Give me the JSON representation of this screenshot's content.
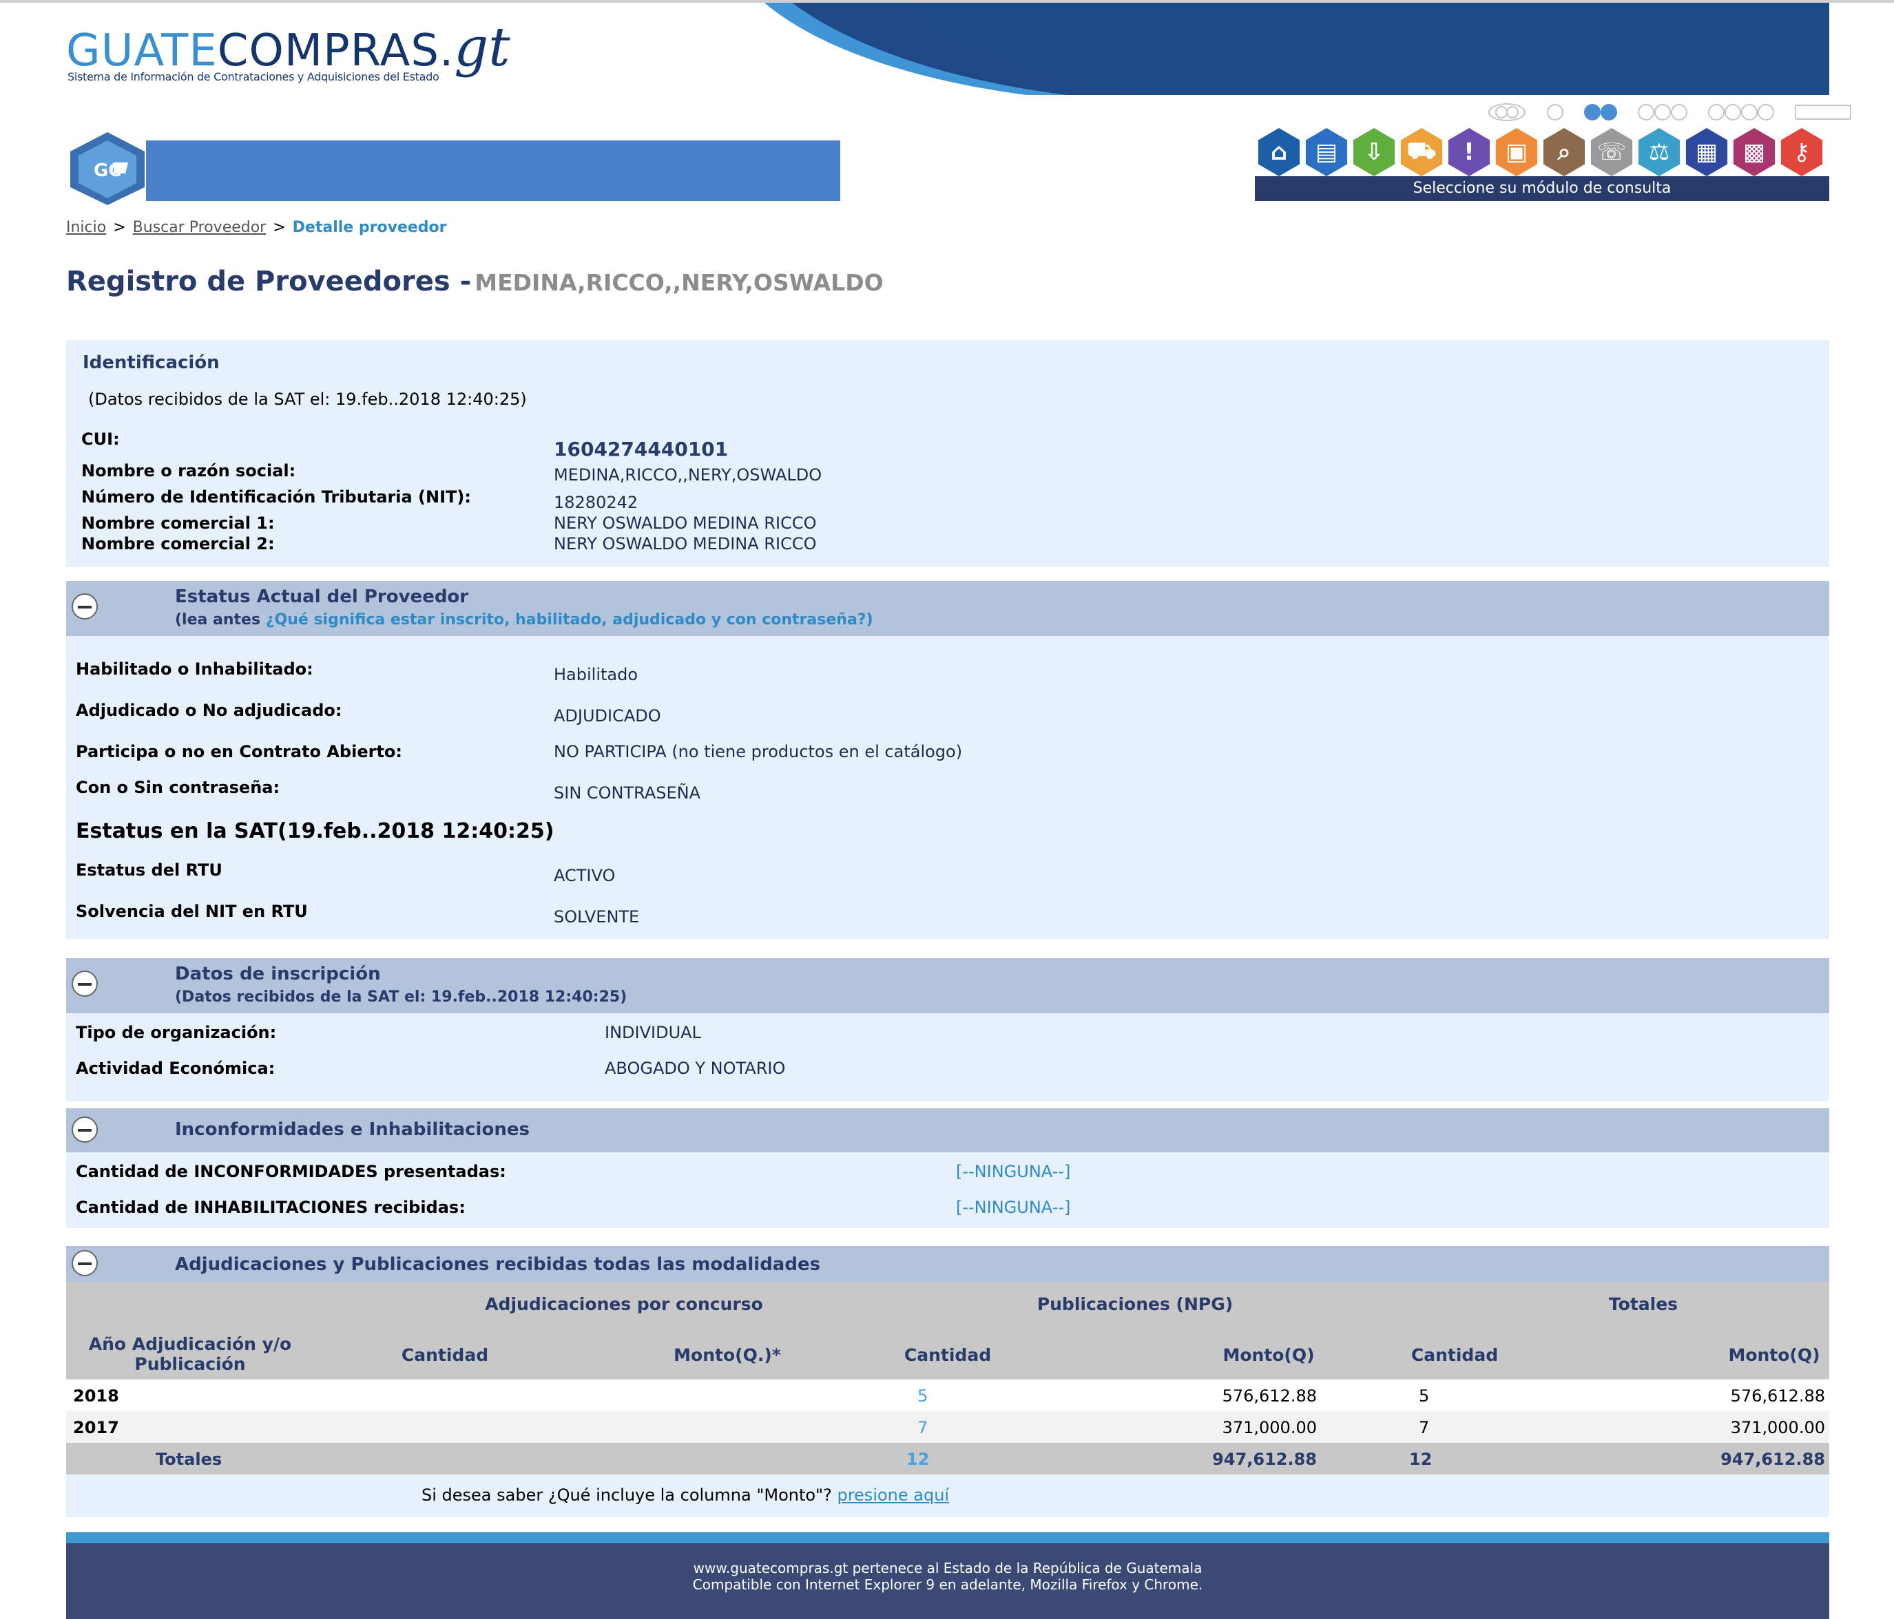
{
  "header": {
    "logo_part1": "GUATE",
    "logo_part2": "COMPRAS.",
    "logo_part3": "gt",
    "logo_subtitle": "Sistema de Información de Contrataciones y Adquisiciones del Estado",
    "gc_logo_text": "GC",
    "modules_label": "Seleccione su módulo de consulta",
    "module_icons": [
      "home-icon",
      "document-icon",
      "download-icon",
      "cart-icon",
      "alert-icon",
      "pac-icon",
      "search-icon",
      "phone-icon",
      "scale-icon",
      "report-icon",
      "grid-icon",
      "key-icon"
    ],
    "module_colors": [
      "#1d5ea8",
      "#2a6fc2",
      "#5fae3e",
      "#eda13a",
      "#6a4fb0",
      "#ef8a3a",
      "#8c6a4c",
      "#9a9a9a",
      "#3a9fc9",
      "#2e4aa0",
      "#a8366c",
      "#e0463a"
    ]
  },
  "breadcrumb": {
    "home": "Inicio",
    "search": "Buscar Proveedor",
    "separator": ">",
    "current": "Detalle proveedor"
  },
  "page": {
    "title": "Registro de Proveedores -",
    "subtitle": "MEDINA,RICCO,,NERY,OSWALDO"
  },
  "identificacion": {
    "heading": "Identificación",
    "sat_note": "(Datos recibidos de la SAT el: 19.feb..2018 12:40:25)",
    "cui_label": "CUI:",
    "cui_value": "1604274440101",
    "nombre_label": "Nombre o razón social:",
    "nombre_value": "MEDINA,RICCO,,NERY,OSWALDO",
    "nit_label": "Número de Identificación Tributaria (NIT):",
    "nit_value": "18280242",
    "comercial1_label": "Nombre comercial 1:",
    "comercial1_value": "NERY OSWALDO MEDINA RICCO",
    "comercial2_label": "Nombre comercial 2:",
    "comercial2_value": "NERY OSWALDO MEDINA RICCO"
  },
  "estatus": {
    "heading": "Estatus Actual del Proveedor",
    "note_prefix": "(lea antes",
    "note_link": "¿Qué significa estar inscrito, habilitado, adjudicado y con contraseña?)",
    "habilitado_label": "Habilitado o Inhabilitado:",
    "habilitado_value": "Habilitado",
    "adjudicado_label": "Adjudicado o No adjudicado:",
    "adjudicado_value": "ADJUDICADO",
    "contrato_label": "Participa o no en Contrato Abierto:",
    "contrato_value": "NO PARTICIPA (no tiene productos en el catálogo)",
    "contrasena_label": "Con o Sin contraseña:",
    "contrasena_value": "SIN CONTRASEÑA",
    "sat_heading": "Estatus en la SAT(19.feb..2018 12:40:25)",
    "rtu_label": "Estatus del RTU",
    "rtu_value": "ACTIVO",
    "solvencia_label": "Solvencia del NIT en RTU",
    "solvencia_value": "SOLVENTE"
  },
  "inscripcion": {
    "heading": "Datos de inscripción",
    "note": "(Datos recibidos de la SAT el: 19.feb..2018 12:40:25)",
    "tipo_label": "Tipo de organización:",
    "tipo_value": "INDIVIDUAL",
    "actividad_label": "Actividad Económica:",
    "actividad_value": "ABOGADO Y NOTARIO"
  },
  "inconformidades": {
    "heading": "Inconformidades e Inhabilitaciones",
    "inconformidades_label": "Cantidad de INCONFORMIDADES presentadas:",
    "inconformidades_value": "[--NINGUNA--]",
    "inhabilitaciones_label": "Cantidad de INHABILITACIONES recibidas:",
    "inhabilitaciones_value": "[--NINGUNA--]"
  },
  "adjudicaciones": {
    "heading": "Adjudicaciones y Publicaciones recibidas todas las modalidades",
    "group_concurso": "Adjudicaciones por concurso",
    "group_npg": "Publicaciones (NPG)",
    "group_totales": "Totales",
    "col_year_line1": "Año Adjudicación y/o",
    "col_year_line2": "Publicación",
    "col_cantidad": "Cantidad",
    "col_monto_q_star": "Monto(Q.)*",
    "col_monto_q": "Monto(Q)",
    "rows": [
      {
        "year": "2018",
        "npg_cantidad": "5",
        "npg_monto": "576,612.88",
        "tot_cantidad": "5",
        "tot_monto": "576,612.88"
      },
      {
        "year": "2017",
        "npg_cantidad": "7",
        "npg_monto": "371,000.00",
        "tot_cantidad": "7",
        "tot_monto": "371,000.00"
      }
    ],
    "totals": {
      "label": "Totales",
      "npg_cantidad": "12",
      "npg_monto": "947,612.88",
      "tot_cantidad": "12",
      "tot_monto": "947,612.88"
    },
    "note_text": "Si desea saber ¿Qué incluye la columna \"Monto\"?",
    "note_link": "presione aquí"
  },
  "footer": {
    "line1": "www.guatecompras.gt pertenece al Estado de la República de Guatemala",
    "line2": "Compatible con Internet Explorer 9 en adelante, Mozilla Firefox y Chrome."
  }
}
